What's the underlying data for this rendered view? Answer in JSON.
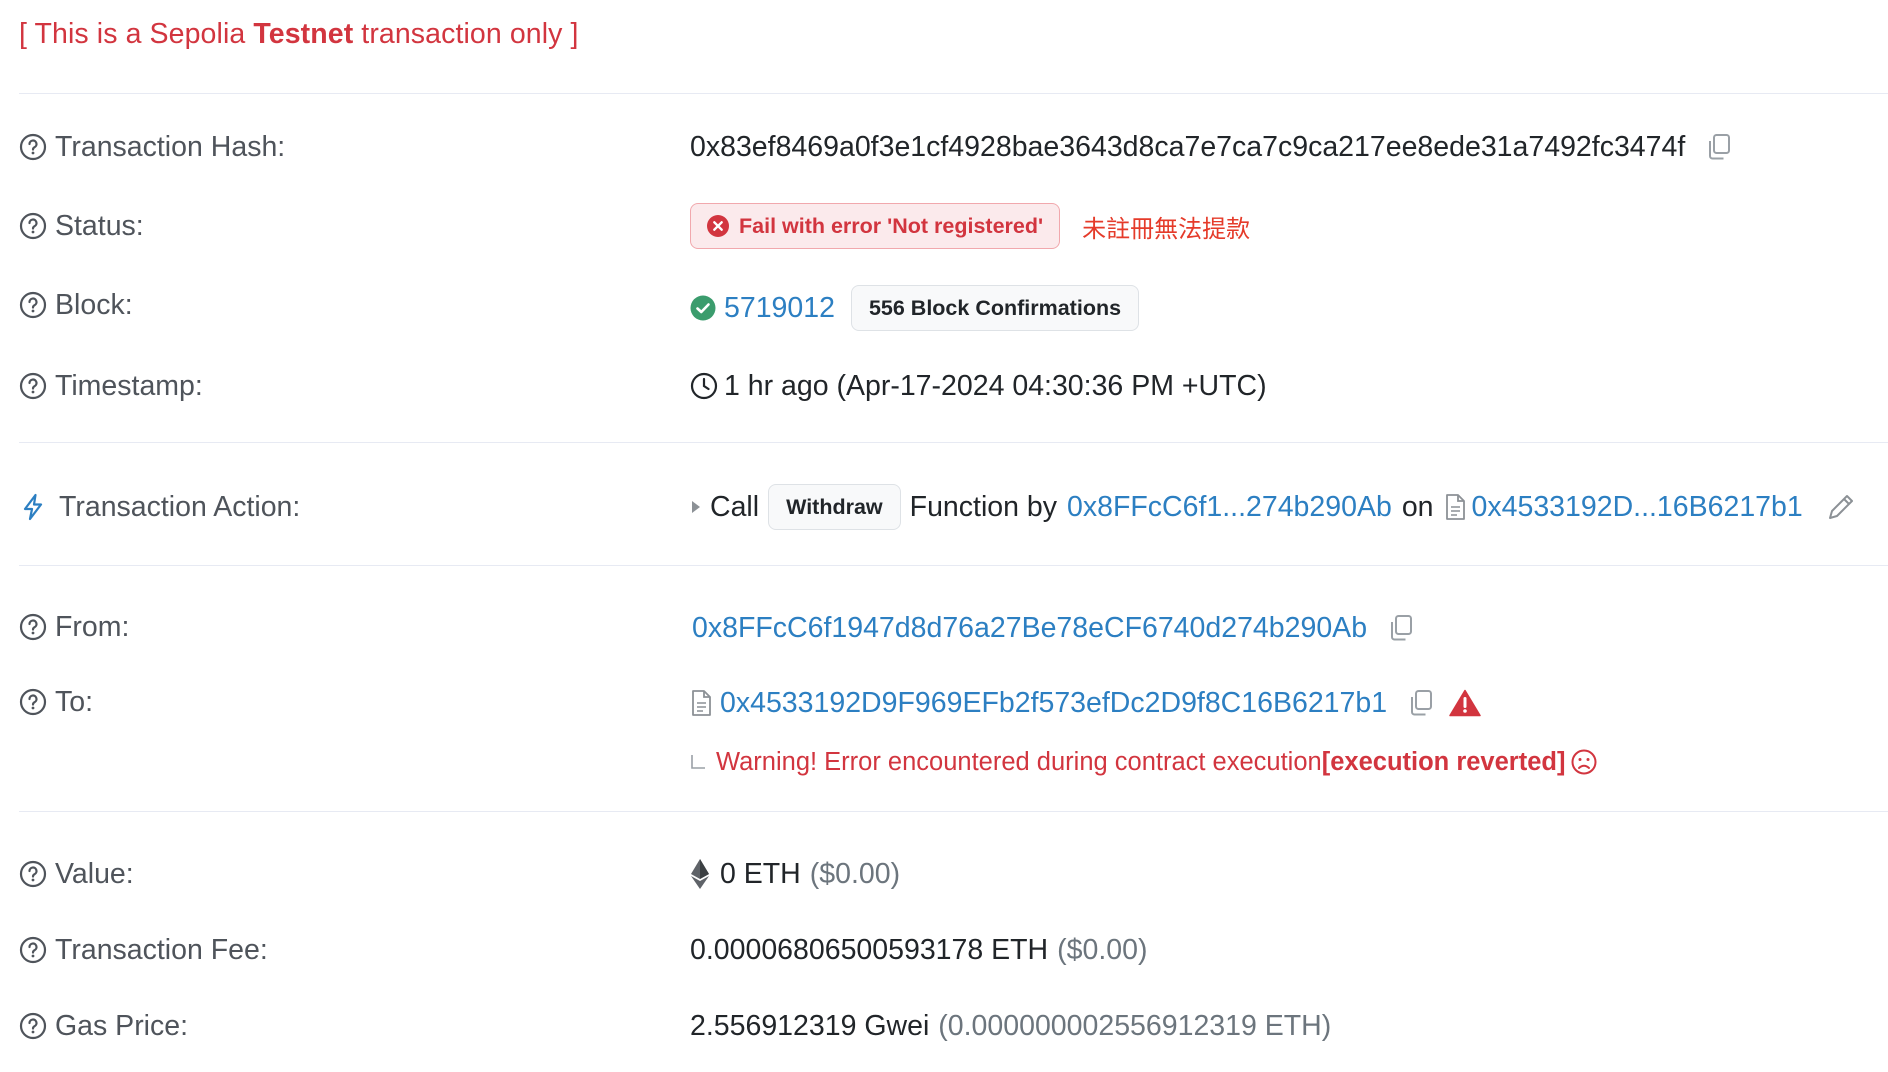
{
  "notice": {
    "prefix": "[ This is a Sepolia ",
    "bold": "Testnet",
    "suffix": " transaction only ]"
  },
  "rows": {
    "tx_hash": {
      "label": "Transaction Hash:",
      "value": "0x83ef8469a0f3e1cf4928bae3643d8ca7e7ca7c9ca217ee8ede31a7492fc3474f"
    },
    "status": {
      "label": "Status:",
      "badge": "Fail with error 'Not registered'",
      "note": "未註冊無法提款"
    },
    "block": {
      "label": "Block:",
      "number": "5719012",
      "confirmations": "556 Block Confirmations"
    },
    "timestamp": {
      "label": "Timestamp:",
      "value": "1 hr ago (Apr-17-2024 04:30:36 PM +UTC)"
    },
    "action": {
      "label": "Transaction Action:",
      "call": "Call",
      "method": "Withdraw",
      "function_by": "Function by",
      "from_short": "0x8FFcC6f1...274b290Ab",
      "on": "on",
      "contract_short": "0x4533192D...16B6217b1"
    },
    "from": {
      "label": "From:",
      "value": "0x8FFcC6f1947d8d76a27Be78eCF6740d274b290Ab"
    },
    "to": {
      "label": "To:",
      "value": "0x4533192D9F969EFb2f573efDc2D9f8C16B6217b1",
      "warning_prefix": "Warning! Error encountered during contract execution ",
      "warning_bold": "[execution reverted]"
    },
    "value": {
      "label": "Value:",
      "amount": "0 ETH",
      "usd": "($0.00)"
    },
    "fee": {
      "label": "Transaction Fee:",
      "amount": "0.00006806500593178 ETH",
      "usd": "($0.00)"
    },
    "gas_price": {
      "label": "Gas Price:",
      "amount": "2.556912319 Gwei",
      "eth": "(0.000000002556912319 ETH)"
    }
  },
  "colors": {
    "link": "#2c7fc2",
    "error": "#d2353f",
    "success": "#3b9c6d",
    "label": "#4f545b"
  },
  "icons": [
    "question-circle-icon",
    "lightning-icon",
    "copy-icon",
    "error-circle-icon",
    "check-circle-icon",
    "clock-icon",
    "caret-right-icon",
    "document-icon",
    "pencil-icon",
    "warning-triangle-icon",
    "frown-icon",
    "ethereum-icon"
  ]
}
